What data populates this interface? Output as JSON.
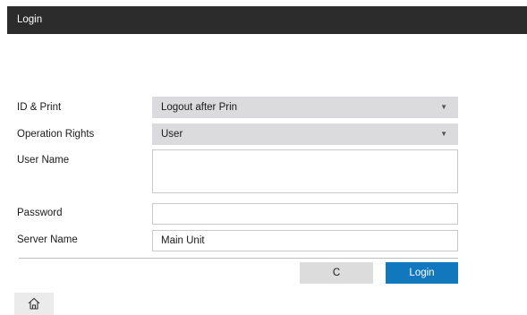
{
  "window": {
    "title": "Login"
  },
  "form": {
    "id_print": {
      "label": "ID & Print",
      "value": "Logout after Prin"
    },
    "operation_rights": {
      "label": "Operation Rights",
      "value": "User"
    },
    "user_name": {
      "label": "User Name",
      "value": ""
    },
    "password": {
      "label": "Password",
      "value": ""
    },
    "server_name": {
      "label": "Server Name",
      "value": "Main Unit"
    }
  },
  "buttons": {
    "clear_label": "C",
    "login_label": "Login"
  },
  "icons": {
    "dropdown": "triangle-down-icon",
    "home": "home-icon"
  },
  "colors": {
    "title_bar": "#2c2c2c",
    "login_button": "#1178bd",
    "select_bg": "#dbdbde"
  }
}
